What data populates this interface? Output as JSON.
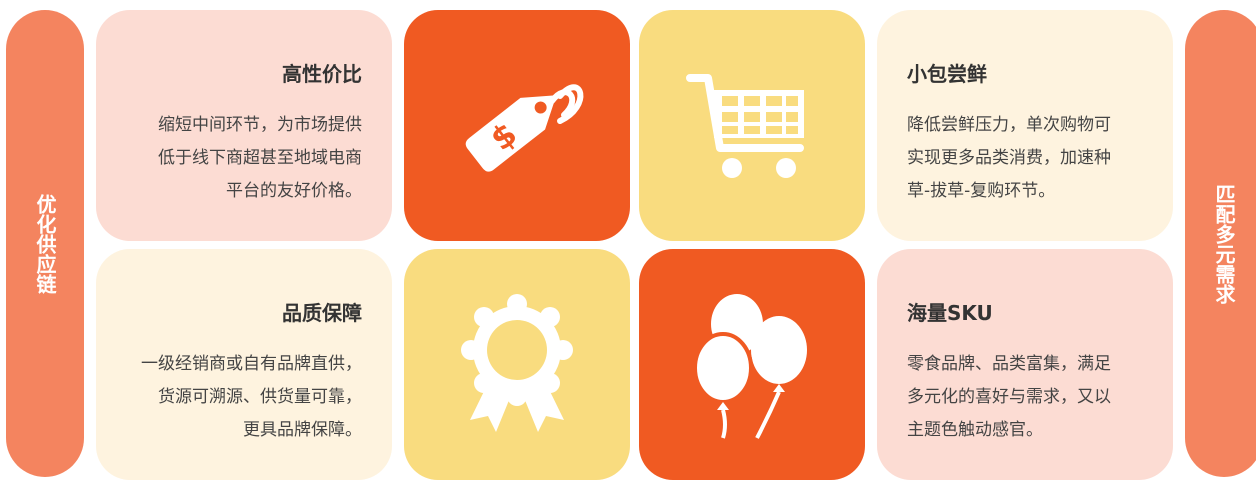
{
  "left_pill": {
    "label": "优化供应链"
  },
  "right_pill": {
    "label": "匹配多元需求"
  },
  "cards": {
    "value": {
      "title": "高性价比",
      "lines": [
        "缩短中间环节，为市场提供",
        "低于线下商超甚至地域电商",
        "平台的友好价格。"
      ]
    },
    "quality": {
      "title": "品质保障",
      "lines": [
        "一级经销商或自有品牌直供，",
        "货源可溯源、供货量可靠，",
        "更具品牌保障。"
      ]
    },
    "trial": {
      "title": "小包尝鲜",
      "lines": [
        "降低尝鲜压力，单次购物可",
        "实现更多品类消费，加速种",
        "草-拔草-复购环节。"
      ]
    },
    "sku": {
      "title": "海量SKU",
      "lines": [
        "零食品牌、品类富集，满足",
        "多元化的喜好与需求，又以",
        "主题色触动感官。"
      ]
    }
  },
  "icons": [
    "price-tag-icon",
    "shopping-cart-icon",
    "award-ribbon-icon",
    "balloons-icon"
  ],
  "colors": {
    "pill": "#F4845F",
    "pink_card": "#FCDCD3",
    "cream_card": "#FEF3DF",
    "orange_tile": "#F05A22",
    "yellow_tile": "#F9DC7F"
  }
}
